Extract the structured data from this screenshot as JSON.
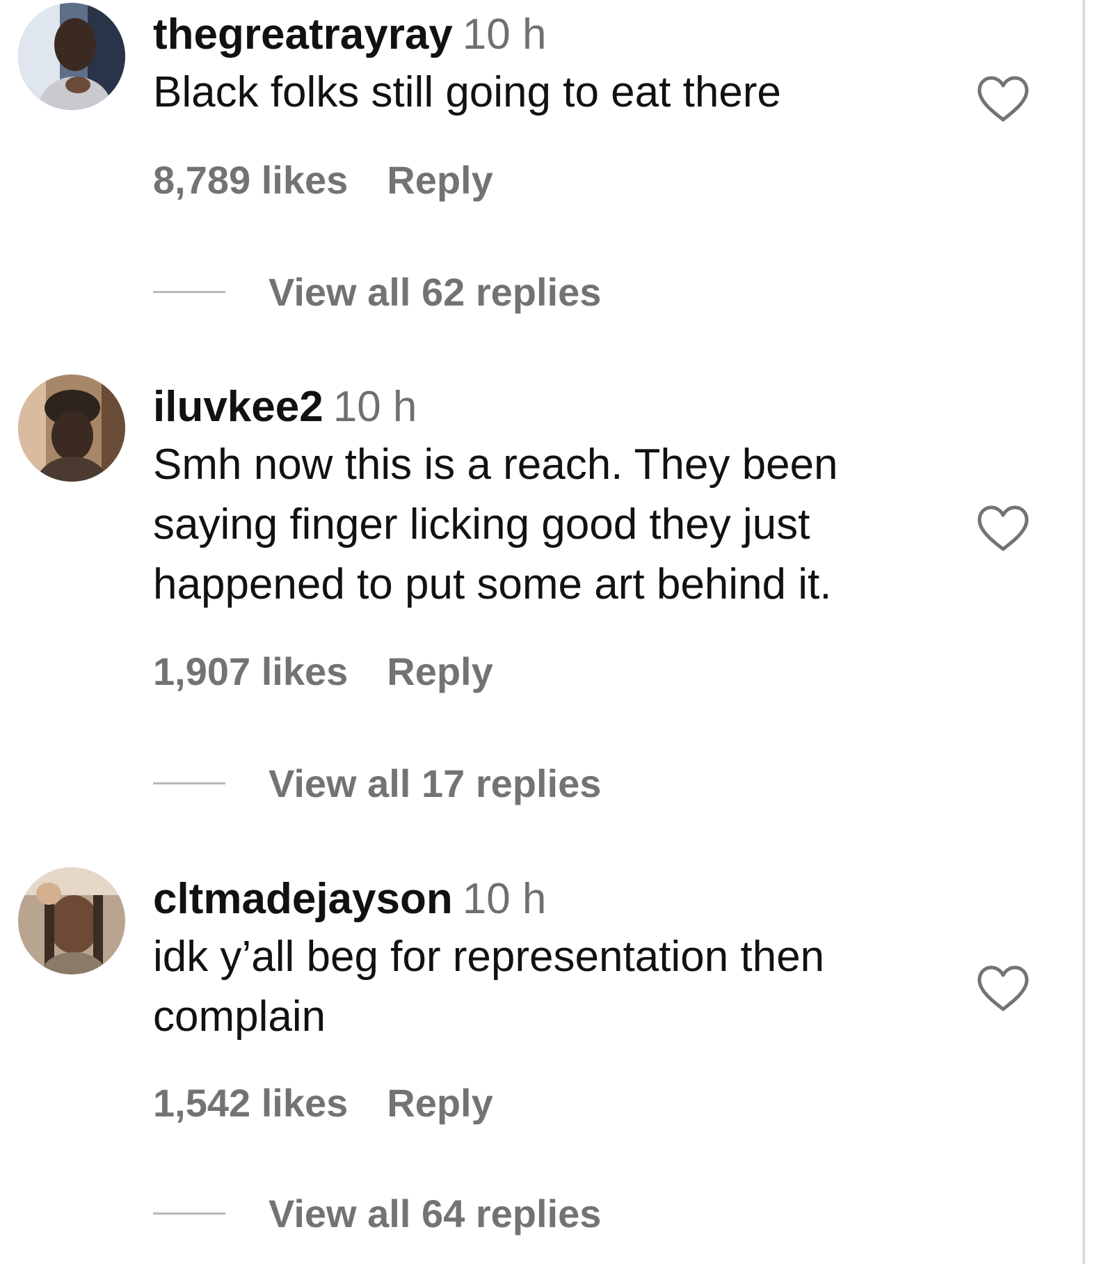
{
  "comments": [
    {
      "username": "thegreatrayray",
      "time": "10 h",
      "text": "Black folks still going to eat there",
      "likes": "8,789 likes",
      "reply_label": "Reply",
      "view_replies": "View all 62 replies",
      "avatar_icon": "user-avatar"
    },
    {
      "username": "iluvkee2",
      "time": "10 h",
      "text": "Smh now this is a reach. They been saying finger licking good they just happened to put some art behind it.",
      "likes": "1,907 likes",
      "reply_label": "Reply",
      "view_replies": "View all 17 replies",
      "avatar_icon": "user-avatar"
    },
    {
      "username": "cltmadejayson",
      "time": "10 h",
      "text": "idk y’all beg for representation then complain",
      "likes": "1,542 likes",
      "reply_label": "Reply",
      "view_replies": "View all 64 replies",
      "avatar_icon": "user-avatar"
    }
  ],
  "colors": {
    "text": "#111111",
    "secondary": "#737373",
    "divider": "#b8b8b8",
    "scrollbar": "#dbdbdb"
  },
  "icons": {
    "like": "heart-outline-icon"
  }
}
